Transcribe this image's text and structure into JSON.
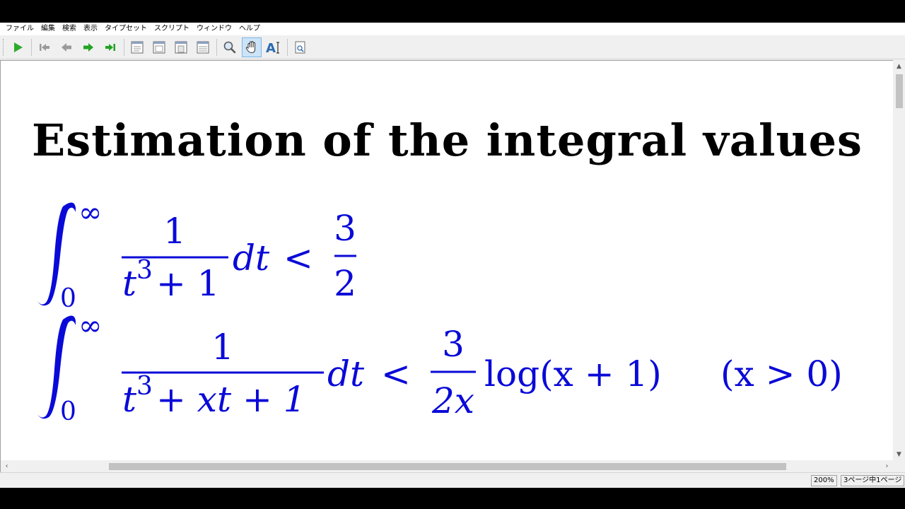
{
  "menu": {
    "items": [
      "ファイル",
      "編集",
      "検索",
      "表示",
      "タイプセット",
      "スクリプト",
      "ウィンドウ",
      "ヘルプ"
    ]
  },
  "toolbar": {
    "buttons": [
      {
        "icon": "play-icon"
      },
      {
        "icon": "first-page-icon"
      },
      {
        "icon": "previous-page-icon"
      },
      {
        "icon": "next-page-icon"
      },
      {
        "icon": "last-page-icon"
      },
      {
        "icon": "single-page-view-icon"
      },
      {
        "icon": "two-page-view-icon"
      },
      {
        "icon": "continuous-view-icon"
      },
      {
        "icon": "fit-width-icon"
      },
      {
        "icon": "magnifier-icon"
      },
      {
        "icon": "hand-tool-icon",
        "active": true
      },
      {
        "icon": "text-select-icon"
      },
      {
        "icon": "page-search-icon"
      }
    ],
    "accent_colors": {
      "play": "#2eaa2e",
      "nav_inactive": "#9a9a9a",
      "nav_active": "#23a323",
      "active_bg": "#cce4f7"
    }
  },
  "document": {
    "title": "Estimation of the integral values",
    "math_color": "#0a0ad8",
    "equation1": {
      "integral_lower": "0",
      "integral_upper": "∞",
      "numerator": "1",
      "denominator_base": "t",
      "denominator_exp": "3",
      "denominator_rest": "+ 1",
      "differential": "dt",
      "relation": "<",
      "rhs_numerator": "3",
      "rhs_denominator": "2"
    },
    "equation2": {
      "integral_lower": "0",
      "integral_upper": "∞",
      "numerator": "1",
      "denominator_base": "t",
      "denominator_exp": "3",
      "denominator_rest": "+ xt + 1",
      "differential": "dt",
      "relation": "<",
      "rhs_numerator": "3",
      "rhs_denominator": "2x",
      "rhs_function": "log(x + 1)",
      "condition": "(x > 0)"
    }
  },
  "status": {
    "zoom": "200%",
    "page_info": "3ページ中1ページ"
  }
}
